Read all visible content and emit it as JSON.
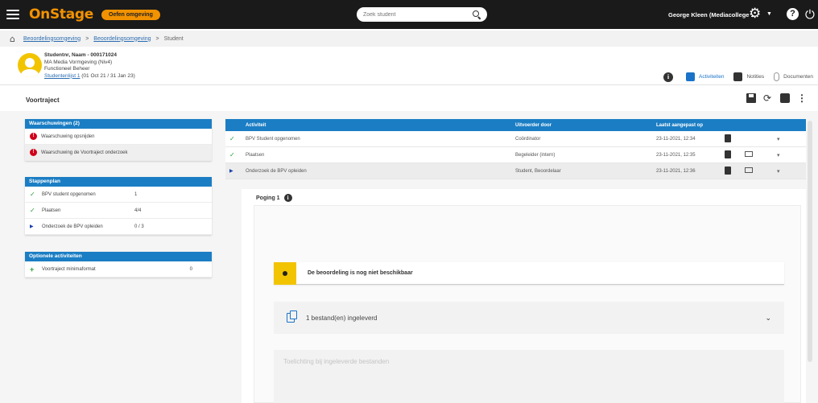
{
  "topbar": {
    "logo": "OnStage",
    "env_badge": "Oefen omgeving",
    "search_placeholder": "Zoek student",
    "user_name": "George Kleen (Mediacollege ..."
  },
  "breadcrumb": [
    "Beoordelingsomgeving",
    "Beoordelingsomgeving",
    "Student"
  ],
  "student": {
    "name": "Studentnr, Naam - 000171024",
    "line2": "MA Media Vormgeving (Niv4)",
    "line3": "Functioneel Beheer",
    "link": "Studentenlijst 1",
    "date_range": "(01 Oct 21 / 31 Jan 23)"
  },
  "tabs": [
    {
      "label": "Activiteiten",
      "active": true
    },
    {
      "label": "Notities",
      "active": false
    },
    {
      "label": "Documenten",
      "active": false
    }
  ],
  "page_title": "Voortraject",
  "cards": {
    "warnings": {
      "title": "Waarschuwingen (2)",
      "items": [
        "Waarschuwing opsnijden",
        "Waarschuwing de Voortraject onderzoek"
      ]
    },
    "stages": {
      "title": "Stappenplan",
      "items": [
        {
          "label": "BPV student opgenomen",
          "value": "1",
          "status": "done"
        },
        {
          "label": "Plaatsen",
          "value": "4/4",
          "status": "done"
        },
        {
          "label": "Onderzoek de BPV opleiden",
          "value": "0 / 3",
          "status": "active"
        }
      ]
    },
    "optional": {
      "title": "Optionele activiteiten",
      "items": [
        {
          "label": "Voortraject minimaformat",
          "value": "0"
        }
      ]
    }
  },
  "table": {
    "headers": [
      "Activiteit",
      "Uitvoerder door",
      "Laatst aangepast op"
    ],
    "rows": [
      {
        "status": "done",
        "activity": "BPV Student opgenomen",
        "by": "Coördinator",
        "date": "23-11-2021, 12:34",
        "mail": false,
        "selected": false
      },
      {
        "status": "done",
        "activity": "Plaatsen",
        "by": "Begeleider (intern)",
        "date": "23-11-2021, 12:35",
        "mail": true,
        "selected": false
      },
      {
        "status": "active",
        "activity": "Onderzoek de BPV opleiden",
        "by": "Student, Beoordelaar",
        "date": "23-11-2021, 12:36",
        "mail": true,
        "selected": true
      }
    ]
  },
  "detail": {
    "tab_label": "Poging 1",
    "notice": "De beoordeling is nog niet beschikbaar",
    "files": "1 bestand(en) ingeleverd",
    "comment_placeholder": "Toelichting bij ingeleverde bestanden"
  },
  "colors": {
    "accent": "#1b7ec4",
    "brand": "#f39200",
    "warning": "#d0021b",
    "success": "#2a9d3a",
    "notice": "#f2c400"
  }
}
